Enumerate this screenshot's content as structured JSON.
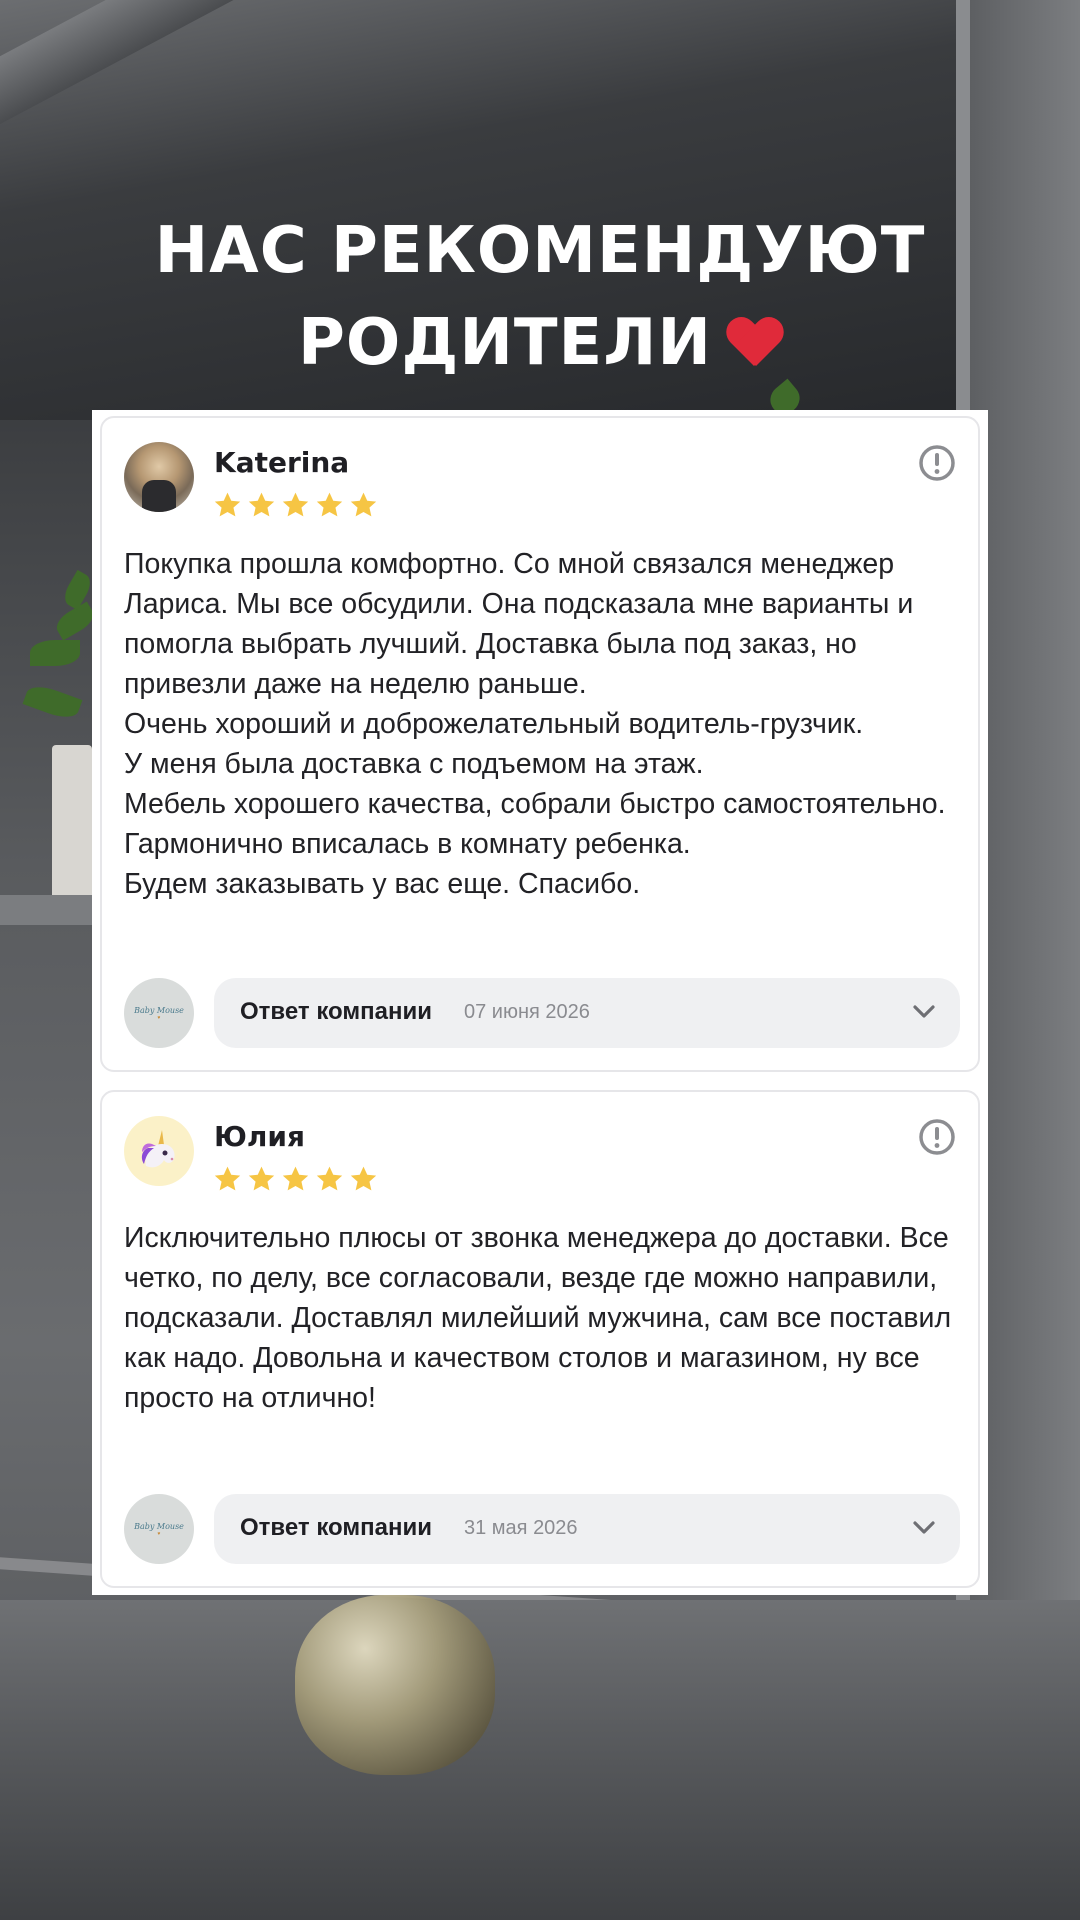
{
  "headline": {
    "line1": "НАС РЕКОМЕНДУЮТ",
    "line2": "РОДИТЕЛИ",
    "emoji": "heart-icon"
  },
  "reviews": [
    {
      "author": "Katerina",
      "rating": 5,
      "max_rating": 5,
      "avatar": "user-photo",
      "text": "Покупка прошла комфортно. Со мной связался менеджер Лариса. Мы все обсудили. Она подсказала мне варианты и помогла выбрать лучший. Доставка была под заказ, но привезли даже на неделю раньше.\nОчень хороший и доброжелательный водитель-грузчик.\nУ меня была доставка с подъемом на этаж.\nМебель хорошего качества, собрали быстро самостоятельно. Гармонично вписалась в комнату ребенка.\nБудем заказывать у вас еще. Спасибо.",
      "reply": {
        "label": "Ответ компании",
        "date": "07 июня 2026",
        "logo": "Baby Mouse"
      }
    },
    {
      "author": "Юлия",
      "rating": 5,
      "max_rating": 5,
      "avatar": "unicorn-icon",
      "text": "Исключительно плюсы от звонка менеджера до доставки. Все четко, по делу, все согласовали, везде где можно направили, подсказали. Доставлял милейший мужчина, сам все поставил как надо. Довольна и качеством столов и магазином, ну все просто на отлично!",
      "reply": {
        "label": "Ответ компании",
        "date": "31 мая 2026",
        "logo": "Baby Mouse"
      }
    }
  ],
  "colors": {
    "star": "#f6c544",
    "heart": "#e02a3a",
    "card_border": "#e6e6e9",
    "reply_bg": "#eff0f2"
  }
}
